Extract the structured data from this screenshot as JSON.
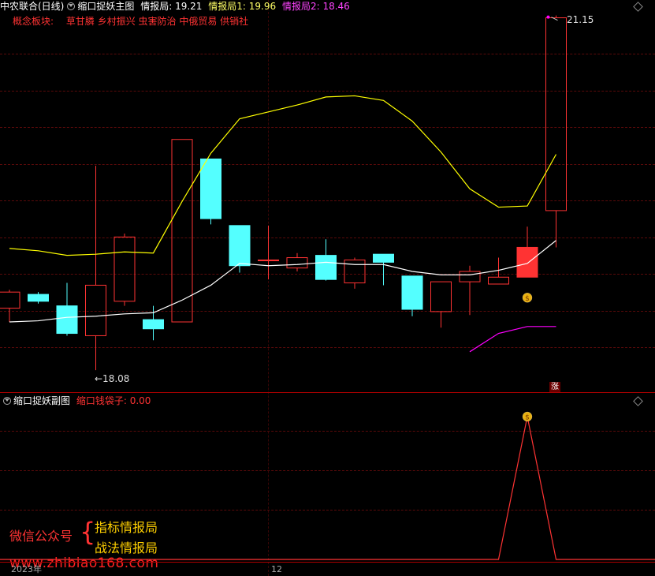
{
  "main_panel": {
    "stock_name": "中农联合(日线)",
    "indicator_name": "缩口捉妖主图",
    "legend": [
      {
        "label": "情报局: ",
        "value": "19.21",
        "color": "#ffffff"
      },
      {
        "label": "情报局1: ",
        "value": "19.96",
        "color": "#ffff66"
      },
      {
        "label": "情报局2: ",
        "value": "18.46",
        "color": "#ff33ff"
      }
    ],
    "concept_label": "概念板块:",
    "concept_items": "草甘膦 乡村振兴 虫害防治 中俄贸易 供销社",
    "high_label": "21.15",
    "low_label": "←18.08",
    "zhang_badge": "涨"
  },
  "sub_panel": {
    "indicator_name": "缩口捉妖副图",
    "legend_label": "缩口钱袋子: ",
    "legend_value": "0.00"
  },
  "watermark": {
    "left_text": "微信公众号",
    "line1": "指标情报局",
    "line2": "战法情报局",
    "url": "www.zhibiao168.com"
  },
  "time_axis": {
    "year": "2023年",
    "month": "12"
  },
  "colors": {
    "up": "#ff3333",
    "down": "#54ffff",
    "ma_white": "#ffffff",
    "ma_yellow": "#ffff00",
    "ma_magenta": "#ff00ff",
    "grid": "#5a0a0a"
  },
  "chart_data": [
    {
      "type": "candlestick",
      "title": "缩口捉妖主图",
      "candles": [
        {
          "open": 18.62,
          "close": 18.76,
          "high": 18.78,
          "low": 18.5
        },
        {
          "open": 18.74,
          "close": 18.68,
          "high": 18.76,
          "low": 18.66
        },
        {
          "open": 18.64,
          "close": 18.4,
          "high": 18.84,
          "low": 18.38
        },
        {
          "open": 18.38,
          "close": 18.82,
          "high": 19.86,
          "low": 18.08
        },
        {
          "open": 18.68,
          "close": 19.24,
          "high": 19.27,
          "low": 18.64
        },
        {
          "open": 18.52,
          "close": 18.44,
          "high": 18.64,
          "low": 18.34
        },
        {
          "open": 18.5,
          "close": 20.09,
          "high": 20.09,
          "low": 18.5
        },
        {
          "open": 19.92,
          "close": 19.4,
          "high": 19.92,
          "low": 19.35
        },
        {
          "open": 19.34,
          "close": 18.99,
          "high": 19.34,
          "low": 18.93
        },
        {
          "open": 19.04,
          "close": 19.04,
          "high": 19.34,
          "low": 18.87
        },
        {
          "open": 18.97,
          "close": 19.06,
          "high": 19.1,
          "low": 18.94
        },
        {
          "open": 19.08,
          "close": 18.87,
          "high": 19.22,
          "low": 18.86
        },
        {
          "open": 18.84,
          "close": 19.04,
          "high": 19.06,
          "low": 18.79
        },
        {
          "open": 19.09,
          "close": 19.02,
          "high": 19.05,
          "low": 18.82
        },
        {
          "open": 18.9,
          "close": 18.61,
          "high": 18.9,
          "low": 18.55
        },
        {
          "open": 18.59,
          "close": 18.85,
          "high": 18.85,
          "low": 18.45
        },
        {
          "open": 18.85,
          "close": 18.94,
          "high": 18.99,
          "low": 18.56
        },
        {
          "open": 18.83,
          "close": 18.89,
          "high": 19.06,
          "low": 18.83
        },
        {
          "open": 18.89,
          "close": 19.15,
          "high": 19.33,
          "low": 18.89
        },
        {
          "open": 19.47,
          "close": 21.15,
          "high": 21.17,
          "low": 19.15
        }
      ],
      "series": [
        {
          "name": "情报局",
          "color": "#ffffff",
          "values": [
            18.5,
            18.51,
            18.54,
            18.55,
            18.57,
            18.58,
            18.69,
            18.82,
            19.01,
            18.99,
            19.0,
            19.02,
            19.0,
            19.0,
            18.94,
            18.91,
            18.91,
            18.95,
            19.01,
            19.21
          ]
        },
        {
          "name": "情报局1",
          "color": "#ffff00",
          "values": [
            19.14,
            19.12,
            19.08,
            19.09,
            19.11,
            19.1,
            19.55,
            19.97,
            20.27,
            20.33,
            20.39,
            20.46,
            20.47,
            20.43,
            20.25,
            19.98,
            19.66,
            19.5,
            19.51,
            19.96
          ]
        },
        {
          "name": "情报局2",
          "color": "#ff00ff",
          "values": [
            null,
            null,
            null,
            null,
            null,
            null,
            null,
            null,
            null,
            null,
            null,
            null,
            null,
            null,
            null,
            null,
            18.24,
            18.4,
            18.46,
            18.46
          ]
        }
      ],
      "ylim": [
        17.95,
        21.25
      ],
      "annotations": [
        "21.15",
        "←18.08"
      ]
    },
    {
      "type": "line",
      "title": "缩口捉妖副图",
      "series": [
        {
          "name": "缩口钱袋子",
          "color": "#ff3333",
          "values": [
            0,
            0,
            0,
            0,
            0,
            0,
            0,
            0,
            0,
            0,
            0,
            0,
            0,
            0,
            0,
            0,
            0,
            0,
            1,
            0
          ]
        }
      ],
      "ylim": [
        0,
        1
      ]
    }
  ]
}
